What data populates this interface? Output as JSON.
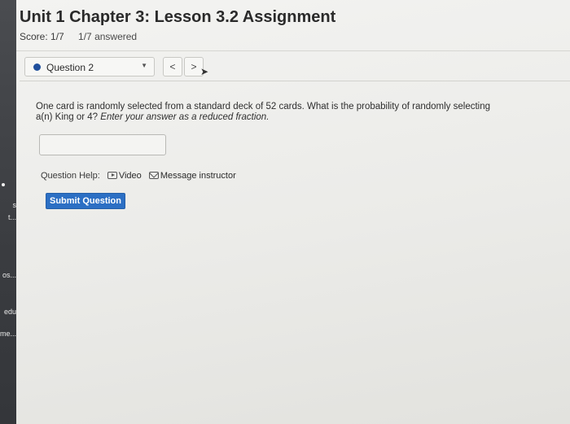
{
  "sidebar": {
    "fragments": [
      "s",
      "t...",
      "os...",
      "edu",
      "me..."
    ]
  },
  "header": {
    "title": "Unit 1 Chapter 3: Lesson 3.2 Assignment",
    "score": "Score: 1/7",
    "answered": "1/7 answered"
  },
  "question_nav": {
    "selected": "Question 2",
    "prev_icon": "chevron-left-icon",
    "next_icon": "chevron-right-icon",
    "prev_glyph": "<",
    "next_glyph": ">"
  },
  "question": {
    "text": "One card is randomly selected from a standard deck of 52 cards. What is the probability of randomly selecting a(n) King or 4?",
    "instruction": "Enter your answer as a reduced fraction.",
    "answer_value": ""
  },
  "help": {
    "label": "Question Help:",
    "video": "Video",
    "message": "Message instructor"
  },
  "submit_label": "Submit Question",
  "colors": {
    "accent": "#2c6fc4",
    "bullet": "#1f4f9c"
  }
}
